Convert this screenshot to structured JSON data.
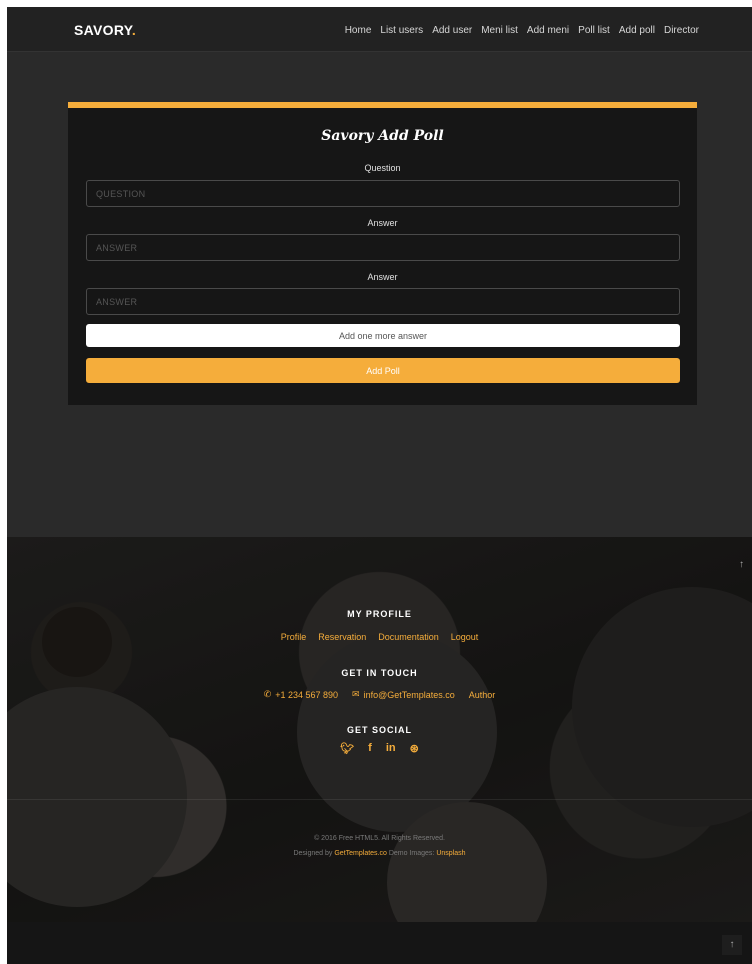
{
  "brand": {
    "name": "SAVORY",
    "dot": "."
  },
  "nav": {
    "items": [
      "Home",
      "List users",
      "Add user",
      "Meni list",
      "Add meni",
      "Poll list",
      "Add poll",
      "Director"
    ]
  },
  "form": {
    "title": "Savory Add Poll",
    "question_label": "Question",
    "question_placeholder": "QUESTION",
    "answer1_label": "Answer",
    "answer1_placeholder": "ANSWER",
    "answer2_label": "Answer",
    "answer2_placeholder": "ANSWER",
    "add_more_label": "Add one more answer",
    "submit_label": "Add Poll"
  },
  "footer": {
    "profile_title": "MY PROFILE",
    "profile_links": [
      "Profile",
      "Reservation",
      "Documentation",
      "Logout"
    ],
    "touch_title": "GET IN TOUCH",
    "phone": "+1 234 567 890",
    "email": "info@GetTemplates.co",
    "author": "Author",
    "social_title": "GET SOCIAL",
    "social_icons": [
      "twitter-icon",
      "facebook-icon",
      "linkedin-icon",
      "dribbble-icon"
    ],
    "copyright": "© 2016 Free HTML5. All Rights Reserved.",
    "designed_prefix": "Designed by",
    "designed_link": "GetTemplates.co",
    "demo_prefix": "Demo Images:",
    "demo_link": "Unsplash"
  },
  "colors": {
    "accent": "#f5ad3b",
    "background": "#2a2a2a",
    "card": "#161616"
  },
  "icons": {
    "go_top": "arrow-up-icon"
  }
}
